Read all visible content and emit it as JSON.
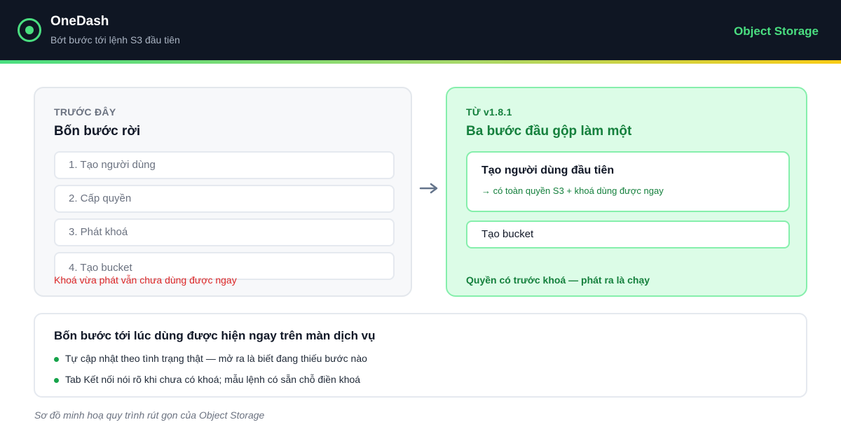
{
  "header": {
    "app_title": "OneDash",
    "subtitle": "Bớt bước tới lệnh S3 đầu tiên",
    "product": "Object Storage",
    "logo_icon": "target-circle-icon",
    "accent_color": "#4ade80"
  },
  "before": {
    "eyebrow": "TRƯỚC ĐÂY",
    "title": "Bốn bước rời",
    "steps": [
      "1. Tạo người dùng",
      "2. Cấp quyền",
      "3. Phát khoá",
      "4. Tạo bucket"
    ],
    "warning": "Khoá vừa phát vẫn chưa dùng được ngay"
  },
  "transition_icon": "arrow-right-icon",
  "after": {
    "eyebrow": "TỪ v1.8.1",
    "title": "Ba bước đầu gộp làm một",
    "merged_step": {
      "title": "Tạo người dùng đầu tiên",
      "note": "→ có toàn quyền S3 + khoá dùng được ngay"
    },
    "step": "Tạo bucket",
    "footer": "Quyền có trước khoá — phát ra là chạy"
  },
  "summary": {
    "title": "Bốn bước tới lúc dùng được hiện ngay trên màn dịch vụ",
    "bullets": [
      "Tự cập nhật theo tình trạng thật — mở ra là biết đang thiếu bước nào",
      "Tab Kết nối nói rõ khi chưa có khoá; mẫu lệnh có sẵn chỗ điền khoá"
    ]
  },
  "caption": "Sơ đồ minh hoạ quy trình rút gọn của Object Storage"
}
